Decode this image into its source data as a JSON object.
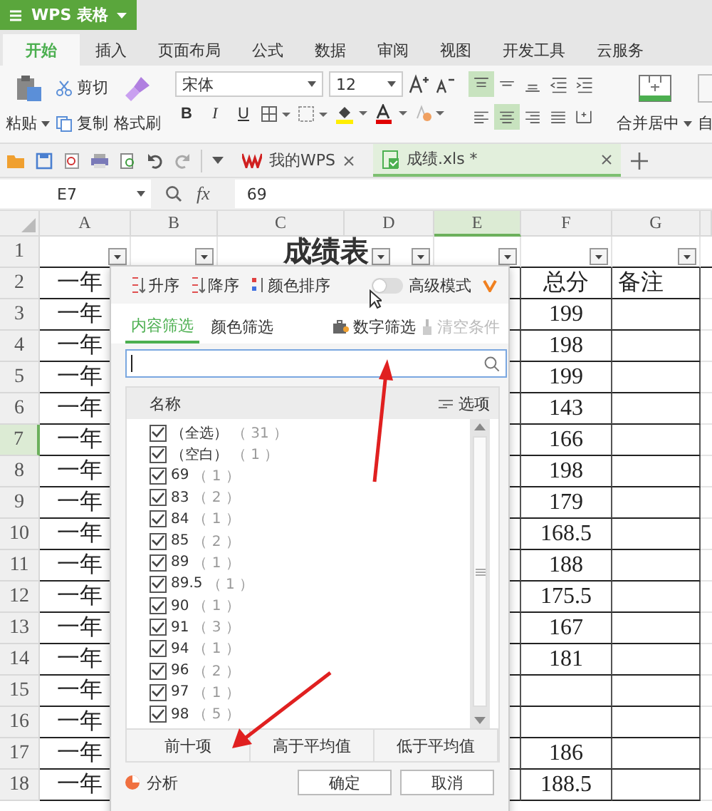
{
  "app": {
    "title": "WPS 表格"
  },
  "ribbon_tabs": [
    {
      "label": "开始",
      "selected": true
    },
    {
      "label": "插入",
      "selected": false
    },
    {
      "label": "页面布局",
      "selected": false
    },
    {
      "label": "公式",
      "selected": false
    },
    {
      "label": "数据",
      "selected": false
    },
    {
      "label": "审阅",
      "selected": false
    },
    {
      "label": "视图",
      "selected": false
    },
    {
      "label": "开发工具",
      "selected": false
    },
    {
      "label": "云服务",
      "selected": false
    }
  ],
  "toolbar": {
    "paste": "粘贴",
    "cut": "剪切",
    "copy": "复制",
    "format_painter": "格式刷",
    "font": "宋体",
    "font_size": "12",
    "bold": "B",
    "italic": "I",
    "underline": "U",
    "merge": "合并居中",
    "auto_cut": "自"
  },
  "doc_tabs": [
    {
      "label": "我的WPS",
      "selected": false,
      "kind": "home"
    },
    {
      "label": "成绩.xls *",
      "selected": true,
      "kind": "sheet"
    }
  ],
  "formula_bar": {
    "cell": "E7",
    "fx": "fx",
    "value": "69"
  },
  "sheet": {
    "title": "成绩表",
    "columns": [
      {
        "label": "A",
        "selected": false
      },
      {
        "label": "B",
        "selected": false
      },
      {
        "label": "C",
        "selected": false
      },
      {
        "label": "D",
        "selected": false
      },
      {
        "label": "E",
        "selected": true
      },
      {
        "label": "F",
        "selected": false
      },
      {
        "label": "G",
        "selected": false
      }
    ],
    "rows": [
      {
        "number": "1",
        "selected": false
      },
      {
        "number": "2",
        "selected": false,
        "col_a": "一年",
        "col_f": "总分",
        "col_g": "备注"
      },
      {
        "number": "3",
        "selected": false,
        "col_a": "一年",
        "col_f": "199"
      },
      {
        "number": "4",
        "selected": false,
        "col_a": "一年",
        "col_f": "198"
      },
      {
        "number": "5",
        "selected": false,
        "col_a": "一年",
        "col_f": "199"
      },
      {
        "number": "6",
        "selected": false,
        "col_a": "一年",
        "col_f": "143"
      },
      {
        "number": "7",
        "selected": true,
        "col_a": "一年",
        "col_f": "166"
      },
      {
        "number": "8",
        "selected": false,
        "col_a": "一年",
        "col_f": "198"
      },
      {
        "number": "9",
        "selected": false,
        "col_a": "一年",
        "col_f": "179"
      },
      {
        "number": "10",
        "selected": false,
        "col_a": "一年",
        "col_f": "168.5"
      },
      {
        "number": "11",
        "selected": false,
        "col_a": "一年",
        "col_f": "188"
      },
      {
        "number": "12",
        "selected": false,
        "col_a": "一年",
        "col_f": "175.5"
      },
      {
        "number": "13",
        "selected": false,
        "col_a": "一年",
        "col_f": "167"
      },
      {
        "number": "14",
        "selected": false,
        "col_a": "一年",
        "col_f": "181"
      },
      {
        "number": "15",
        "selected": false,
        "col_a": "一年"
      },
      {
        "number": "16",
        "selected": false,
        "col_a": "一年"
      },
      {
        "number": "17",
        "selected": false,
        "col_a": "一年",
        "col_f": "186"
      },
      {
        "number": "18",
        "selected": false,
        "col_a": "一年",
        "col_f": "188.5"
      }
    ]
  },
  "filter_dialog": {
    "sort": [
      "升序",
      "降序",
      "颜色排序"
    ],
    "advanced": {
      "label": "高级模式",
      "on": false
    },
    "tabs": [
      {
        "label": "内容筛选",
        "selected": true
      },
      {
        "label": "颜色筛选",
        "selected": false
      }
    ],
    "number_filter": "数字筛选",
    "clear": {
      "label": "清空条件",
      "disabled": true
    },
    "list_header": "名称",
    "options": "选项",
    "items": [
      {
        "label": "（全选）",
        "count": "（ 31 ）",
        "checked": true
      },
      {
        "label": "（空白）",
        "count": "（ 1 ）",
        "checked": true
      },
      {
        "label": "69",
        "count": "（ 1 ）",
        "checked": true
      },
      {
        "label": "83",
        "count": "（ 2 ）",
        "checked": true
      },
      {
        "label": "84",
        "count": "（ 1 ）",
        "checked": true
      },
      {
        "label": "85",
        "count": "（ 2 ）",
        "checked": true
      },
      {
        "label": "89",
        "count": "（ 1 ）",
        "checked": true
      },
      {
        "label": "89.5",
        "count": "（ 1 ）",
        "checked": true
      },
      {
        "label": "90",
        "count": "（ 1 ）",
        "checked": true
      },
      {
        "label": "91",
        "count": "（ 3 ）",
        "checked": true
      },
      {
        "label": "94",
        "count": "（ 1 ）",
        "checked": true
      },
      {
        "label": "96",
        "count": "（ 2 ）",
        "checked": true
      },
      {
        "label": "97",
        "count": "（ 1 ）",
        "checked": true
      },
      {
        "label": "98",
        "count": "（ 5 ）",
        "checked": true
      }
    ],
    "quick": [
      "前十项",
      "高于平均值",
      "低于平均值"
    ],
    "analysis": "分析",
    "buttons": [
      "确定",
      "取消"
    ]
  }
}
